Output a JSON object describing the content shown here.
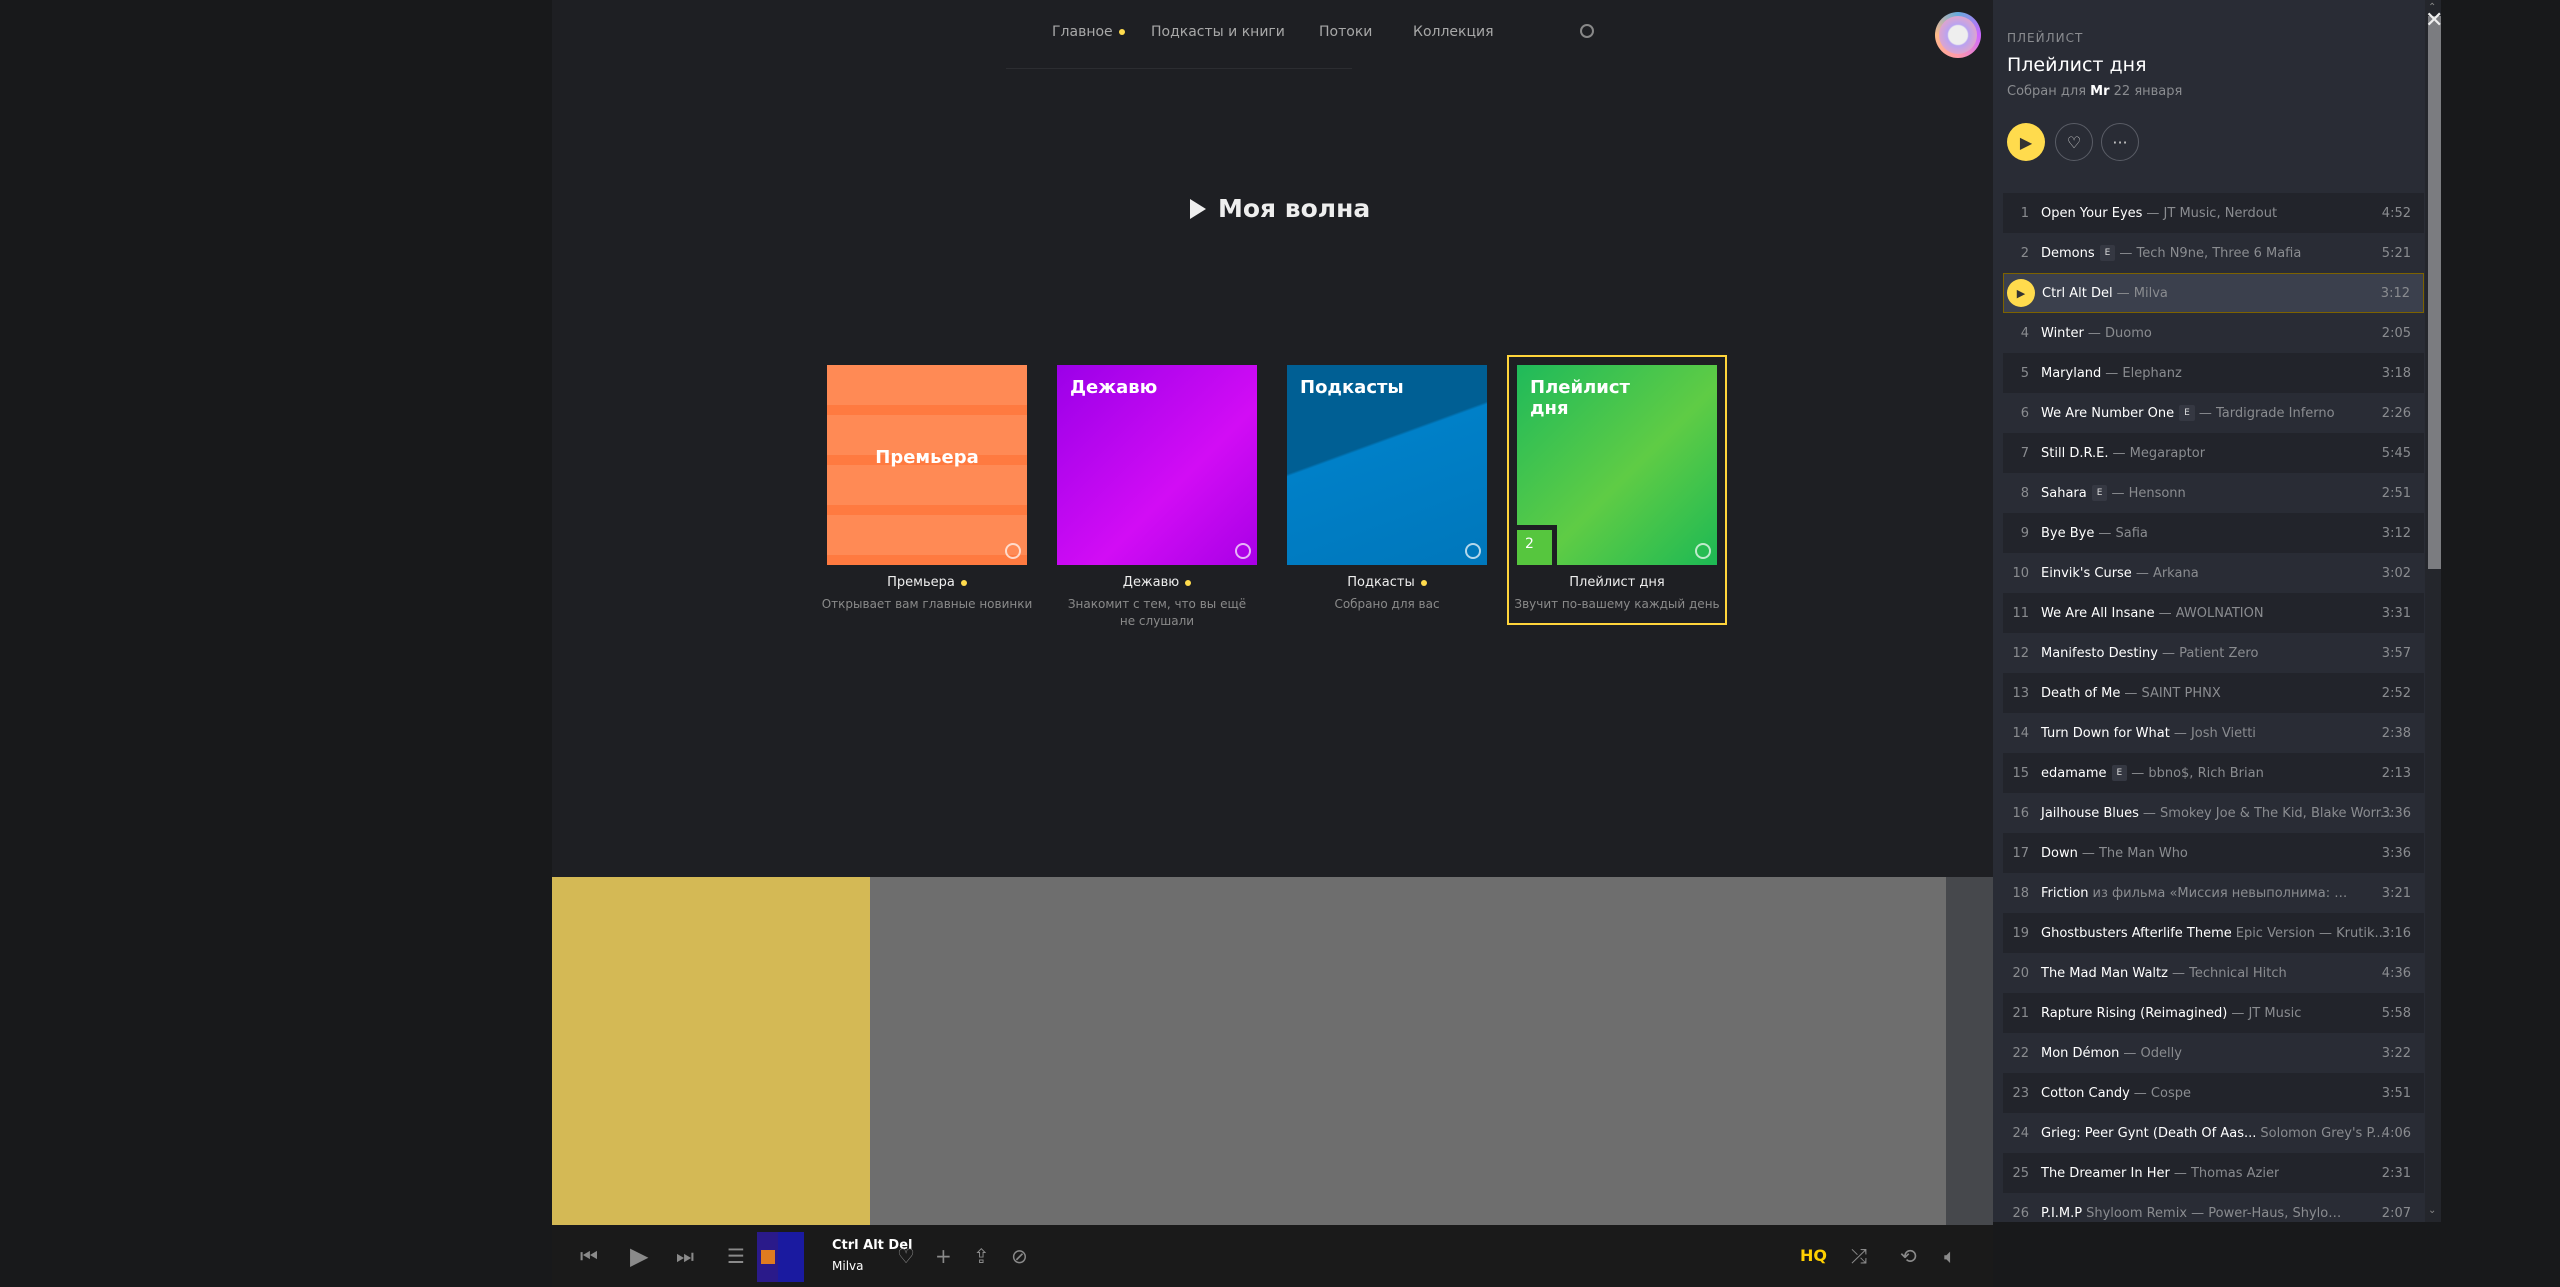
{
  "nav": {
    "items": [
      "Главное",
      "Подкасты и книги",
      "Потоки",
      "Коллекция"
    ]
  },
  "wave": {
    "title": "Моя волна"
  },
  "cards": [
    {
      "cover": "Премьера",
      "name": "Премьера",
      "desc": "Открывает вам главные новинки",
      "dot": true
    },
    {
      "cover": "Дежавю",
      "name": "Дежавю",
      "desc": "Знакомит с тем, что вы ещё не слушали",
      "dot": true
    },
    {
      "cover": "Подкасты",
      "name": "Подкасты",
      "desc": "Собрано для вас",
      "dot": true
    },
    {
      "cover": "Плейлист дня",
      "name": "Плейлист дня",
      "desc": "Звучит по-вашему каждый день",
      "dot": false,
      "badge": "2"
    }
  ],
  "panel": {
    "kind": "ПЛЕЙЛИСТ",
    "title": "Плейлист дня",
    "sub_prefix": "Собран для",
    "user": "Mr",
    "date": "22 января"
  },
  "tracks": [
    {
      "n": "1",
      "t": "Open Your Eyes",
      "a": "— JT Music, Nerdout",
      "d": "4:52"
    },
    {
      "n": "2",
      "t": "Demons",
      "e": true,
      "a": "— Tech N9ne, Three 6 Mafia",
      "d": "5:21"
    },
    {
      "n": "3",
      "t": "Ctrl Alt Del",
      "a": "— Milva",
      "d": "3:12",
      "current": true
    },
    {
      "n": "4",
      "t": "Winter",
      "a": "— Duomo",
      "d": "2:05"
    },
    {
      "n": "5",
      "t": "Maryland",
      "a": "— Elephanz",
      "d": "3:18"
    },
    {
      "n": "6",
      "t": "We Are Number One",
      "e": true,
      "a": "— Tardigrade Inferno",
      "d": "2:26"
    },
    {
      "n": "7",
      "t": "Still D.R.E.",
      "a": "— Megaraptor",
      "d": "5:45"
    },
    {
      "n": "8",
      "t": "Sahara",
      "e": true,
      "a": "— Hensonn",
      "d": "2:51"
    },
    {
      "n": "9",
      "t": "Bye Bye",
      "a": "— Safia",
      "d": "3:12"
    },
    {
      "n": "10",
      "t": "Einvik's Curse",
      "a": "— Arkana",
      "d": "3:02"
    },
    {
      "n": "11",
      "t": "We Are All Insane",
      "a": "— AWOLNATION",
      "d": "3:31"
    },
    {
      "n": "12",
      "t": "Manifesto Destiny",
      "a": "— Patient Zero",
      "d": "3:57"
    },
    {
      "n": "13",
      "t": "Death of Me",
      "a": "— SAINT PHNX",
      "d": "2:52"
    },
    {
      "n": "14",
      "t": "Turn Down for What",
      "a": "— Josh Vietti",
      "d": "2:38"
    },
    {
      "n": "15",
      "t": "edamame",
      "e": true,
      "a": "— bbno$, Rich Brian",
      "d": "2:13"
    },
    {
      "n": "16",
      "t": "Jailhouse Blues",
      "a": "— Smokey Joe & The Kid, Blake Worr...",
      "d": "3:36"
    },
    {
      "n": "17",
      "t": "Down",
      "a": "— The Man Who",
      "d": "3:36"
    },
    {
      "n": "18",
      "t": "Friction",
      "a": "из фильма «Миссия невыполнима: После...",
      "d": "3:21"
    },
    {
      "n": "19",
      "t": "Ghostbusters Afterlife Theme",
      "a": "Epic Version — Krutik...",
      "d": "3:16"
    },
    {
      "n": "20",
      "t": "The Mad Man Waltz",
      "a": "— Technical Hitch",
      "d": "4:36"
    },
    {
      "n": "21",
      "t": "Rapture Rising (Reimagined)",
      "a": "— JT Music",
      "d": "5:58"
    },
    {
      "n": "22",
      "t": "Mon Démon",
      "a": "— Odelly",
      "d": "3:22"
    },
    {
      "n": "23",
      "t": "Cotton Candy",
      "a": "— Cospe",
      "d": "3:51"
    },
    {
      "n": "24",
      "t": "Grieg: Peer Gynt (Death Of Aas...",
      "a": "Solomon Grey's P...",
      "d": "4:06"
    },
    {
      "n": "25",
      "t": "The Dreamer In Her",
      "a": "— Thomas Azier",
      "d": "2:31"
    },
    {
      "n": "26",
      "t": "P.I.M.P",
      "a": "Shyloom Remix — Power-Haus, Shyloom, Du...",
      "d": "2:07"
    }
  ],
  "player": {
    "title": "Ctrl Alt Del",
    "artist": "Milva",
    "hq": "HQ",
    "progress": 0.2,
    "accent": "#ffdb4d"
  }
}
